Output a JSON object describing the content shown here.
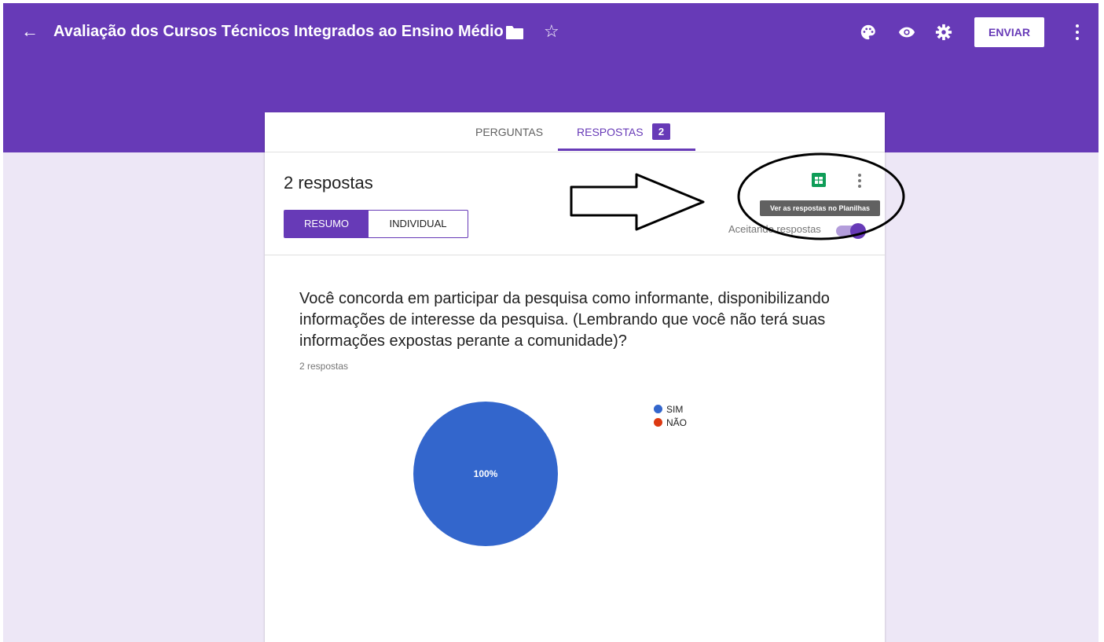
{
  "header": {
    "title": "Avaliação dos Cursos Técnicos Integrados ao Ensino Médio",
    "send_label": "ENVIAR"
  },
  "tabs": [
    {
      "label": "PERGUNTAS"
    },
    {
      "label": "RESPOSTAS",
      "badge": "2"
    }
  ],
  "responses": {
    "count_label": "2 respostas",
    "view_summary": "RESUMO",
    "view_individual": "INDIVIDUAL",
    "sheets_tooltip": "Ver as respostas no Planilhas",
    "accepting_label": "Aceitando respostas",
    "accepting_on": true
  },
  "question": {
    "text": "Você concorda em participar da pesquisa como informante, disponibilizando informações de interesse da pesquisa. (Lembrando que você não terá suas informações expostas perante a comunidade)?",
    "count_label": "2 respostas"
  },
  "chart_data": {
    "type": "pie",
    "categories": [
      "SIM",
      "NÃO"
    ],
    "values": [
      2,
      0
    ],
    "slice_labels": [
      "100%",
      ""
    ],
    "colors": [
      "#3366cc",
      "#dc3912"
    ],
    "legend_position": "right"
  },
  "icons": [
    "arrow-left-icon",
    "folder-icon",
    "star-outline-icon",
    "palette-icon",
    "eye-icon",
    "gear-icon",
    "more-vert-icon",
    "sheets-icon"
  ],
  "colors": {
    "brand": "#673ab7",
    "background": "#ede7f6"
  }
}
